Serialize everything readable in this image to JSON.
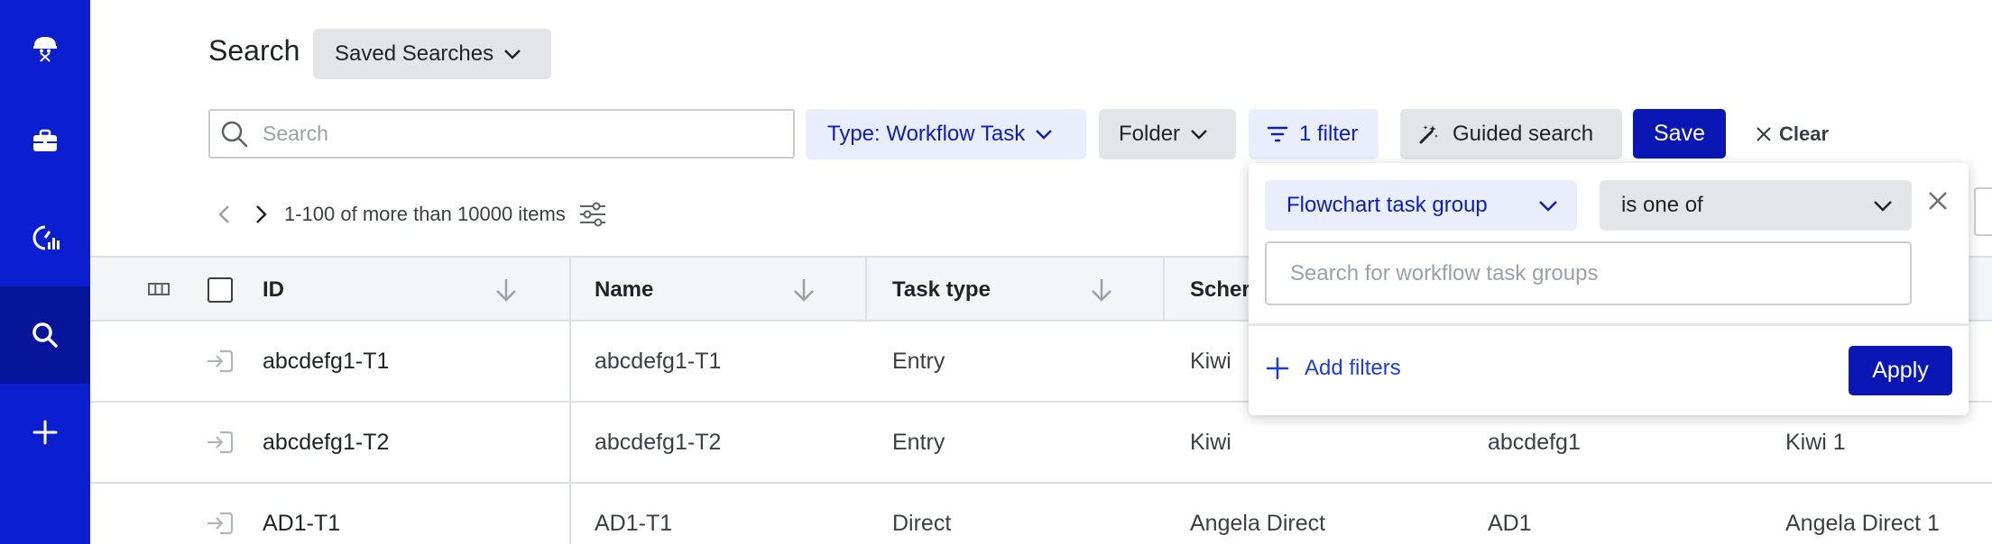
{
  "sidebar": {
    "items": [
      {
        "name": "logo",
        "icon": "robot-icon"
      },
      {
        "name": "workspace",
        "icon": "briefcase-icon"
      },
      {
        "name": "analytics",
        "icon": "gauge-chart-icon"
      },
      {
        "name": "search",
        "icon": "search-icon",
        "active": true
      },
      {
        "name": "create",
        "icon": "plus-icon"
      }
    ]
  },
  "header": {
    "title": "Search",
    "saved_searches_label": "Saved Searches"
  },
  "toolbar": {
    "search_placeholder": "Search",
    "type_chip": "Type: Workflow Task",
    "folder_chip": "Folder",
    "filter_chip": "1 filter",
    "guided_label": "Guided search",
    "save_label": "Save",
    "clear_label": "Clear"
  },
  "pagination": {
    "summary": "1-100 of more than 10000 items"
  },
  "table": {
    "columns": [
      "ID",
      "Name",
      "Task type",
      "Scher"
    ],
    "rows": [
      {
        "id": "abcdefg1-T1",
        "name": "abcdefg1-T1",
        "task_type": "Entry",
        "schema": "Kiwi",
        "col5": "",
        "col6": ""
      },
      {
        "id": "abcdefg1-T2",
        "name": "abcdefg1-T2",
        "task_type": "Entry",
        "schema": "Kiwi",
        "col5": "abcdefg1",
        "col6": "Kiwi 1"
      },
      {
        "id": "AD1-T1",
        "name": "AD1-T1",
        "task_type": "Direct",
        "schema": "Angela Direct",
        "col5": "AD1",
        "col6": "Angela Direct 1"
      }
    ]
  },
  "filter_popover": {
    "field_label": "Flowchart task group",
    "operator_label": "is one of",
    "search_placeholder": "Search for workflow task groups",
    "add_filters_label": "Add filters",
    "apply_label": "Apply"
  },
  "colors": {
    "sidebar": "#0b1fd1",
    "sidebar_active": "#06159a",
    "primary": "#0a17b5",
    "chip_blue_bg": "#eaedfb",
    "chip_gray_bg": "#e4e5e8"
  }
}
